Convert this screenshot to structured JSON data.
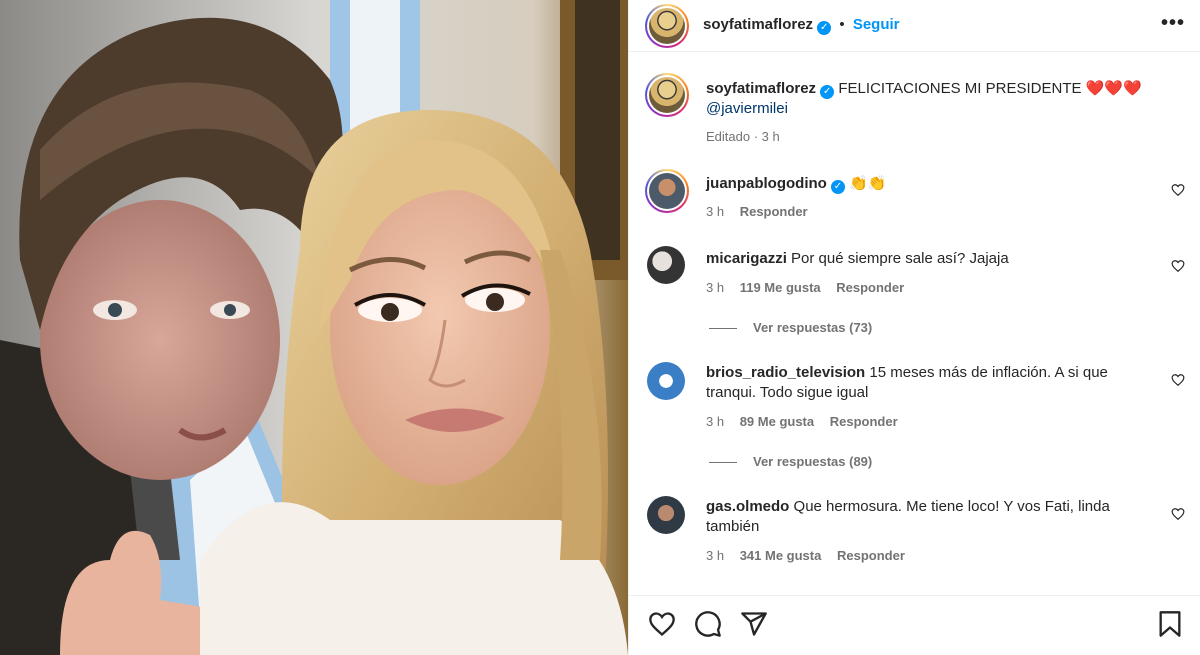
{
  "post": {
    "author": "soyfatimaflorez",
    "follow_label": "Seguir",
    "more_label": "•••",
    "caption_text": "FELICITACIONES MI PRESIDENTE ❤️❤️❤️",
    "caption_mention": "@javiermilei",
    "caption_meta": "Editado · 3 h"
  },
  "comments": [
    {
      "user": "juanpablogodino",
      "verified": true,
      "text": "👏👏",
      "time": "3 h",
      "likes": "",
      "reply_label": "Responder"
    },
    {
      "user": "micarigazzi",
      "verified": false,
      "text": "Por qué siempre sale así? Jajaja",
      "time": "3 h",
      "likes": "119 Me gusta",
      "reply_label": "Responder",
      "view_replies": "Ver respuestas (73)"
    },
    {
      "user": "brios_radio_television",
      "verified": false,
      "text": "15 meses más de inflación. A si que tranqui. Todo sigue igual",
      "time": "3 h",
      "likes": "89 Me gusta",
      "reply_label": "Responder",
      "view_replies": "Ver respuestas (89)"
    },
    {
      "user": "gas.olmedo",
      "verified": false,
      "text": "Que hermosura. Me tiene loco! Y vos Fati, linda también",
      "time": "3 h",
      "likes": "341 Me gusta",
      "reply_label": "Responder"
    }
  ],
  "icons": {
    "verified": "verified-badge-icon",
    "like": "heart-icon",
    "comment": "comment-icon",
    "share": "share-icon",
    "save": "bookmark-icon",
    "more": "more-options-icon"
  },
  "colors": {
    "accent": "#0095f6",
    "text": "#262626",
    "muted": "#737373",
    "divider": "#efefef"
  }
}
